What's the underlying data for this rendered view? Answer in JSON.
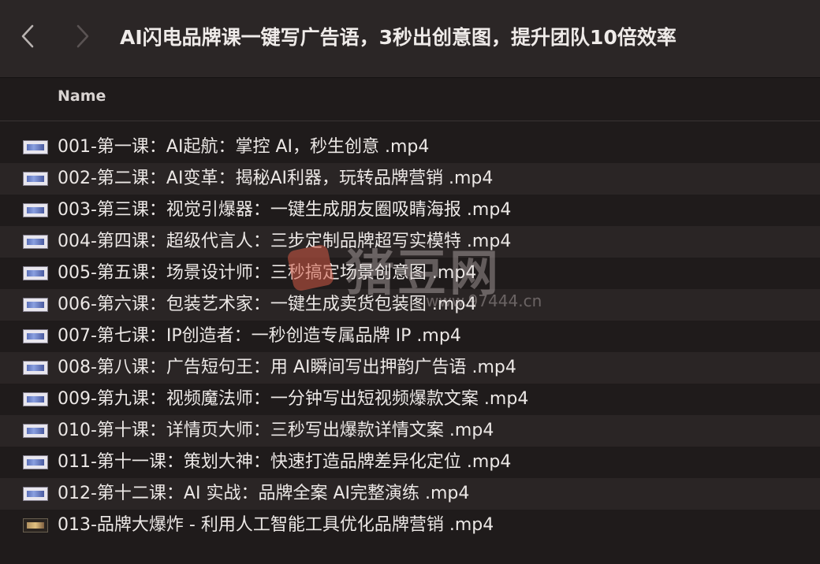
{
  "window": {
    "title": "AI闪电品牌课一键写广告语，3秒出创意图，提升团队10倍效率"
  },
  "header": {
    "name_column": "Name"
  },
  "files": [
    {
      "name": "001-第一课：AI起航：掌控 AI，秒生创意 .mp4",
      "icon": "video-file-icon"
    },
    {
      "name": "002-第二课：AI变革：揭秘AI利器，玩转品牌营销 .mp4",
      "icon": "video-file-icon"
    },
    {
      "name": "003-第三课：视觉引爆器：一键生成朋友圈吸睛海报 .mp4",
      "icon": "video-file-icon"
    },
    {
      "name": "004-第四课：超级代言人：三步定制品牌超写实模特 .mp4",
      "icon": "video-file-icon"
    },
    {
      "name": "005-第五课：场景设计师：三秒搞定场景创意图 .mp4",
      "icon": "video-file-icon"
    },
    {
      "name": "006-第六课：包装艺术家：一键生成卖货包装图 .mp4",
      "icon": "video-file-icon"
    },
    {
      "name": "007-第七课：IP创造者：一秒创造专属品牌 IP .mp4",
      "icon": "video-file-icon"
    },
    {
      "name": "008-第八课：广告短句王：用 AI瞬间写出押韵广告语 .mp4",
      "icon": "video-file-icon"
    },
    {
      "name": "009-第九课：视频魔法师：一分钟写出短视频爆款文案 .mp4",
      "icon": "video-file-icon"
    },
    {
      "name": "010-第十课：详情页大师：三秒写出爆款详情文案 .mp4",
      "icon": "video-file-icon"
    },
    {
      "name": "011-第十一课：策划大神：快速打造品牌差异化定位 .mp4",
      "icon": "video-file-icon"
    },
    {
      "name": "012-第十二课：AI 实战：品牌全案 AI完整演练 .mp4",
      "icon": "video-file-icon"
    },
    {
      "name": "013-品牌大爆炸 - 利用人工智能工具优化品牌营销 .mp4",
      "icon": "video-file-icon-dark"
    }
  ],
  "watermark": {
    "text": "猪豆网",
    "url": "www.97444.cn"
  },
  "colors": {
    "background": "#1f1b1b",
    "titlebar": "#2b2626",
    "row_alt": "#2a2525",
    "text": "#ece8e6"
  }
}
